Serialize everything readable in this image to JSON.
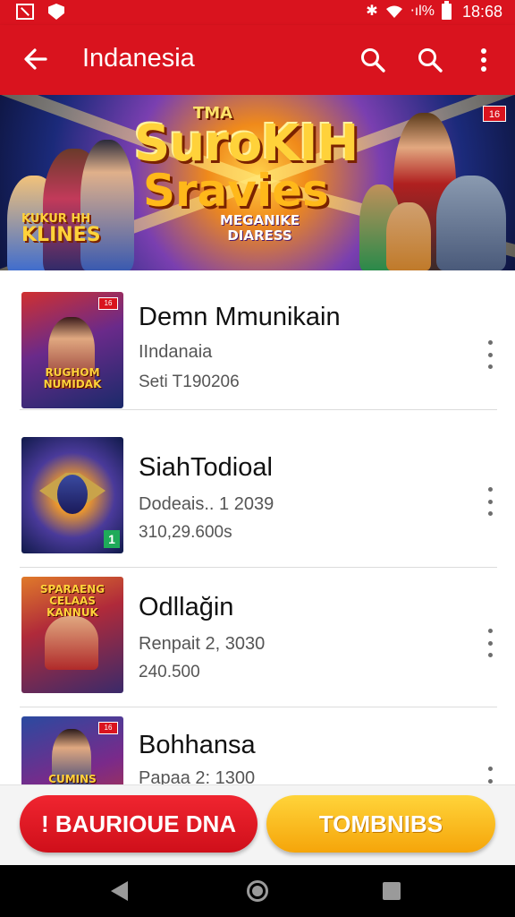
{
  "status_bar": {
    "time": "18:68",
    "signal_text": "⋅ıl%",
    "icons": [
      "screenshot-icon",
      "shield-icon",
      "bluetooth-icon",
      "wifi-icon",
      "signal-icon",
      "battery-icon"
    ]
  },
  "app_bar": {
    "title": "Indanesia",
    "icons": [
      "arrow-left-icon",
      "search-icon",
      "search-icon",
      "more-vert-icon"
    ],
    "color": "#d9131e"
  },
  "banner": {
    "small_title": "TMA",
    "title_line1": "SuroKIH",
    "title_line2": "Sravies",
    "subtitle_line1": "MEGANIKE",
    "subtitle_line2": "DIARESS",
    "left_line1": "KUKUR HH",
    "left_line2": "KLINES",
    "badge": "16"
  },
  "list": {
    "items": [
      {
        "title": "Demn Mmunikain",
        "subtitle": "IIndanaia",
        "meta": "Seti T190206",
        "thumb_text": "RUGHOM NUMIDAK",
        "thumb_badge": "16"
      },
      {
        "title": "SiahTodioal",
        "subtitle": "Dodeais.. 1 2039",
        "meta": "310,29.600s",
        "thumb_text": "",
        "thumb_badge": "1"
      },
      {
        "title": "Odllağin",
        "subtitle": "Renpait 2, 3030",
        "meta": "240.500",
        "thumb_text": "SPARAENG CELAAS KANNUK",
        "thumb_badge": ""
      },
      {
        "title": "Bohhansa",
        "subtitle": "Papaa 2: 1300",
        "meta": "",
        "thumb_text": "CUMINS",
        "thumb_badge": "16"
      }
    ]
  },
  "actions": {
    "primary_label": "! BAURIOUE DNA",
    "secondary_label": "TOMBNIBS",
    "primary_color": "#d9131e",
    "secondary_color": "#f5b21a"
  },
  "nav_bar": {
    "icons": [
      "nav-back-icon",
      "nav-home-icon",
      "nav-recents-icon"
    ]
  }
}
